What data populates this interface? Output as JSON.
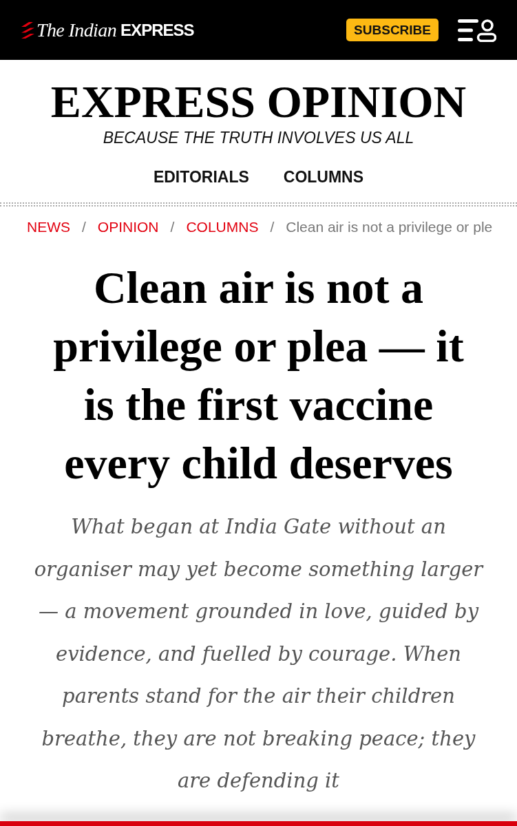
{
  "header": {
    "logo": {
      "words": [
        {
          "text": "The Indian",
          "kind": "serif"
        },
        {
          "text": "EXPRESS",
          "kind": "bold"
        }
      ]
    },
    "subscribe_button": "SUBSCRIBE"
  },
  "section": {
    "title": "EXPRESS OPINION",
    "tagline": "BECAUSE THE TRUTH INVOLVES US ALL",
    "nav": [
      {
        "label": "EDITORIALS"
      },
      {
        "label": "COLUMNS"
      }
    ]
  },
  "breadcrumb": [
    {
      "label": "NEWS",
      "kind": "link"
    },
    {
      "label": "/",
      "kind": "separator"
    },
    {
      "label": "OPINION",
      "kind": "link"
    },
    {
      "label": "/",
      "kind": "separator"
    },
    {
      "label": "COLUMNS",
      "kind": "link"
    },
    {
      "label": "/",
      "kind": "separator"
    },
    {
      "label": "Clean air is not a privilege or ple",
      "kind": "current"
    }
  ],
  "article": {
    "headline": "Clean air is not a privilege or plea — it is the first vaccine every child deserves",
    "summary": "What began at India Gate without an organiser may yet become something larger — a movement grounded in love, guided by evidence, and fuelled by courage. When parents stand for the air their children breathe, they are not breaking peace; they are defending it"
  }
}
